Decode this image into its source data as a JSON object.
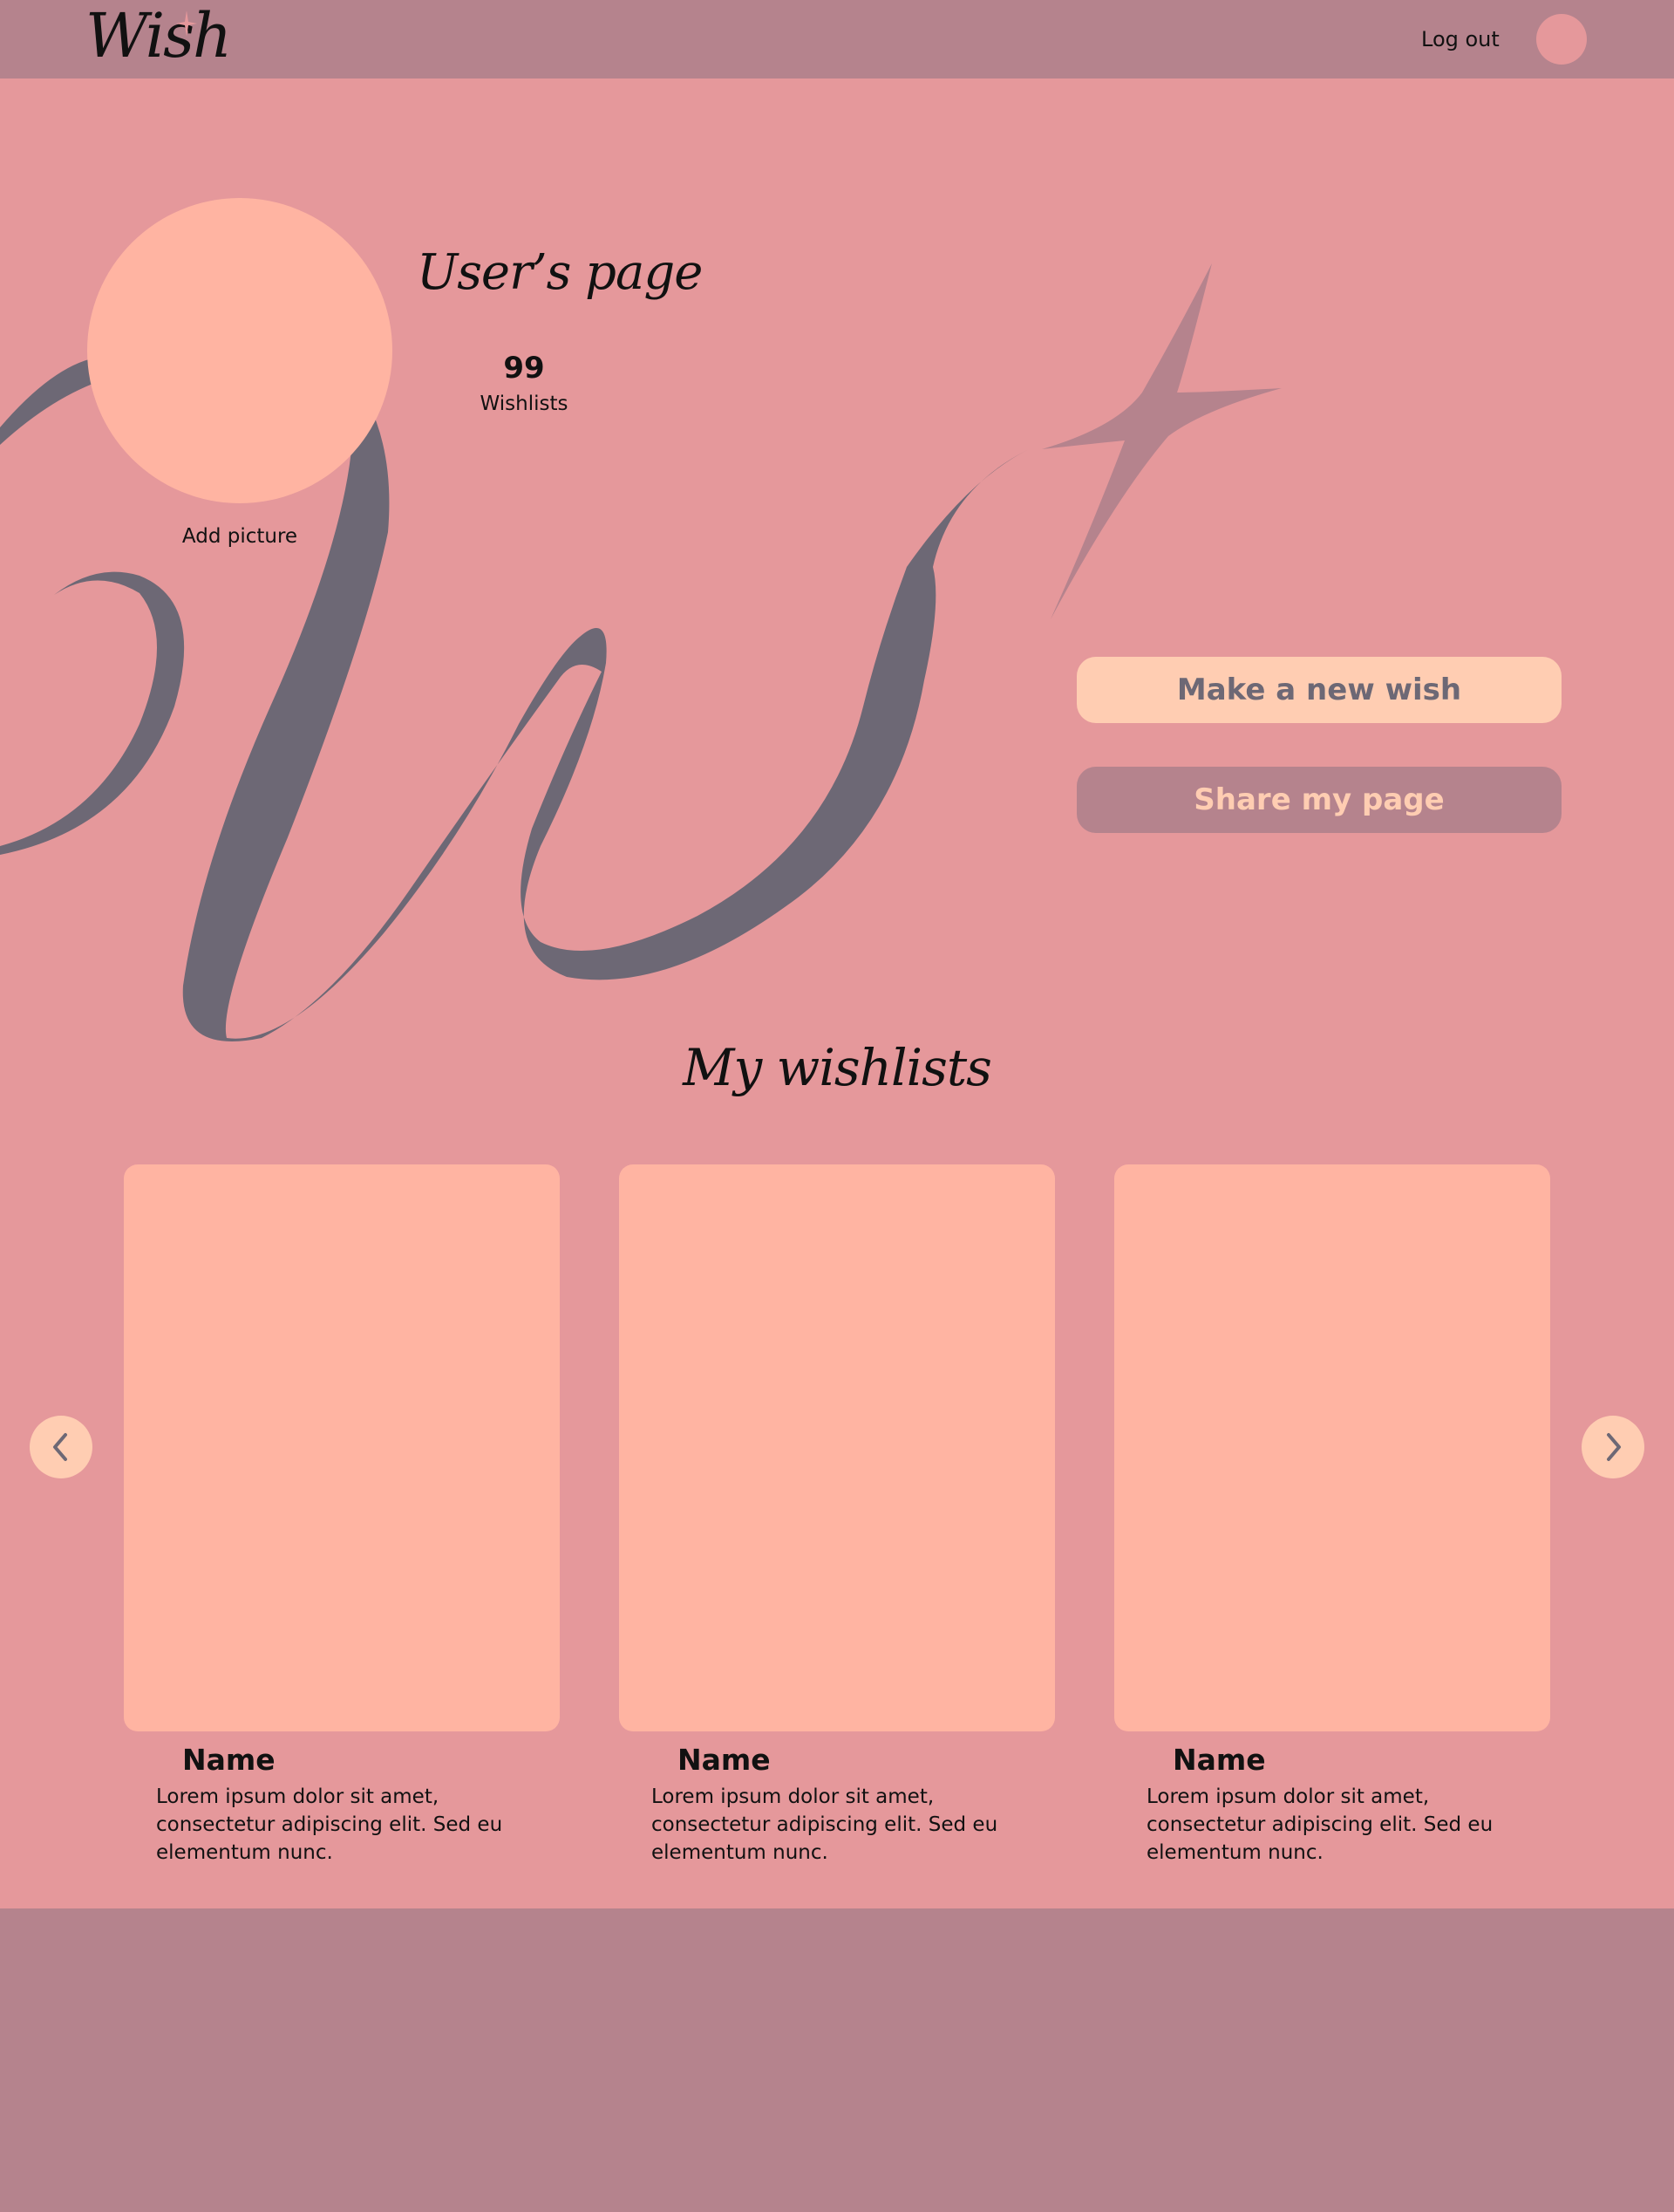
{
  "header": {
    "logo_text": "Wish",
    "logout_label": "Log out",
    "avatar_icon": "user-avatar"
  },
  "profile": {
    "title": "User’s page",
    "wishlist_count": "99",
    "wishlist_count_label": "Wishlists",
    "add_picture_label": "Add picture"
  },
  "actions": {
    "new_wish_label": "Make a new wish",
    "share_label": "Share my page"
  },
  "wishlists": {
    "title": "My wishlists",
    "items": [
      {
        "name": "Name",
        "description": "Lorem ipsum dolor sit amet, consectetur adipiscing elit. Sed eu elementum nunc."
      },
      {
        "name": "Name",
        "description": "Lorem ipsum dolor sit amet, consectetur adipiscing elit. Sed eu elementum nunc."
      },
      {
        "name": "Name",
        "description": "Lorem ipsum dolor sit amet, consectetur adipiscing elit. Sed eu elementum nunc."
      }
    ],
    "prev_icon": "chevron-left-icon",
    "next_icon": "chevron-right-icon"
  },
  "colors": {
    "header_bg": "#b5838d",
    "main_bg": "#e5989b",
    "card_bg": "#ffb4a2",
    "accent_light": "#ffcdb2",
    "accent_dark": "#6d6875"
  }
}
